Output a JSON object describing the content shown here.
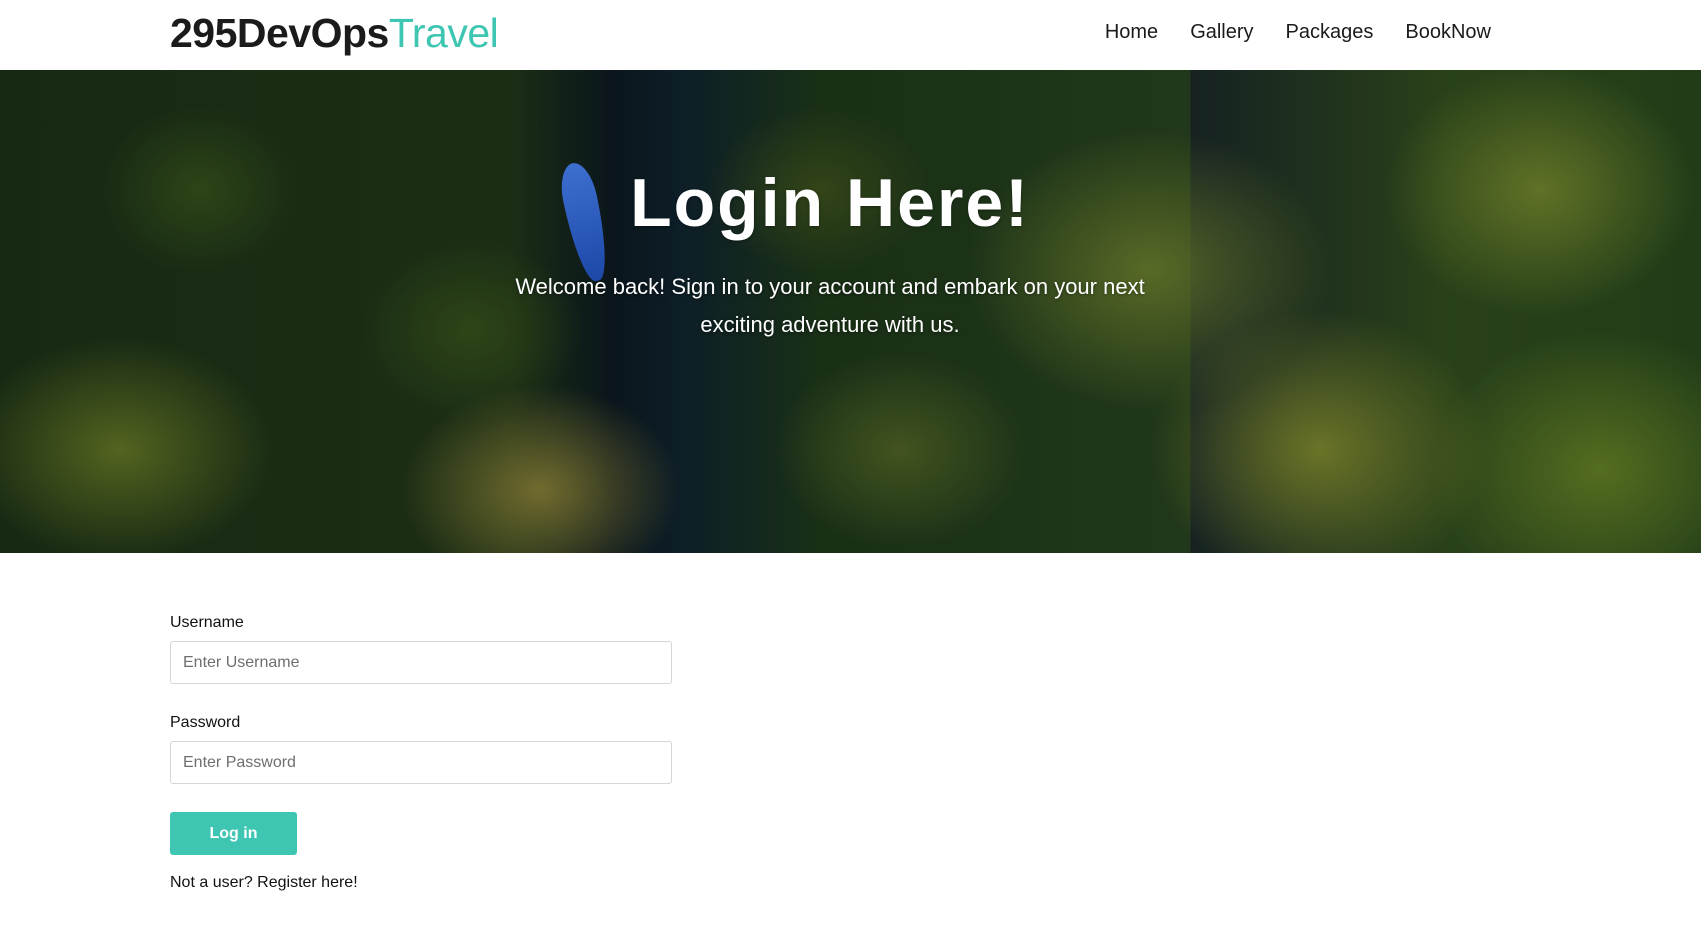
{
  "brand": {
    "main": "295DevOps",
    "accent": "Travel"
  },
  "nav": {
    "items": [
      {
        "label": "Home"
      },
      {
        "label": "Gallery"
      },
      {
        "label": "Packages"
      },
      {
        "label": "BookNow"
      }
    ]
  },
  "hero": {
    "title": "Login Here!",
    "subtitle": "Welcome back! Sign in to your account and embark on your next exciting adventure with us."
  },
  "form": {
    "username_label": "Username",
    "username_placeholder": "Enter Username",
    "username_value": "",
    "password_label": "Password",
    "password_placeholder": "Enter Password",
    "password_value": "",
    "submit_label": "Log in",
    "register_text": "Not a user? Register here!"
  },
  "colors": {
    "accent": "#3ec6b3",
    "text": "#1b1b1b",
    "background": "#ffffff"
  }
}
